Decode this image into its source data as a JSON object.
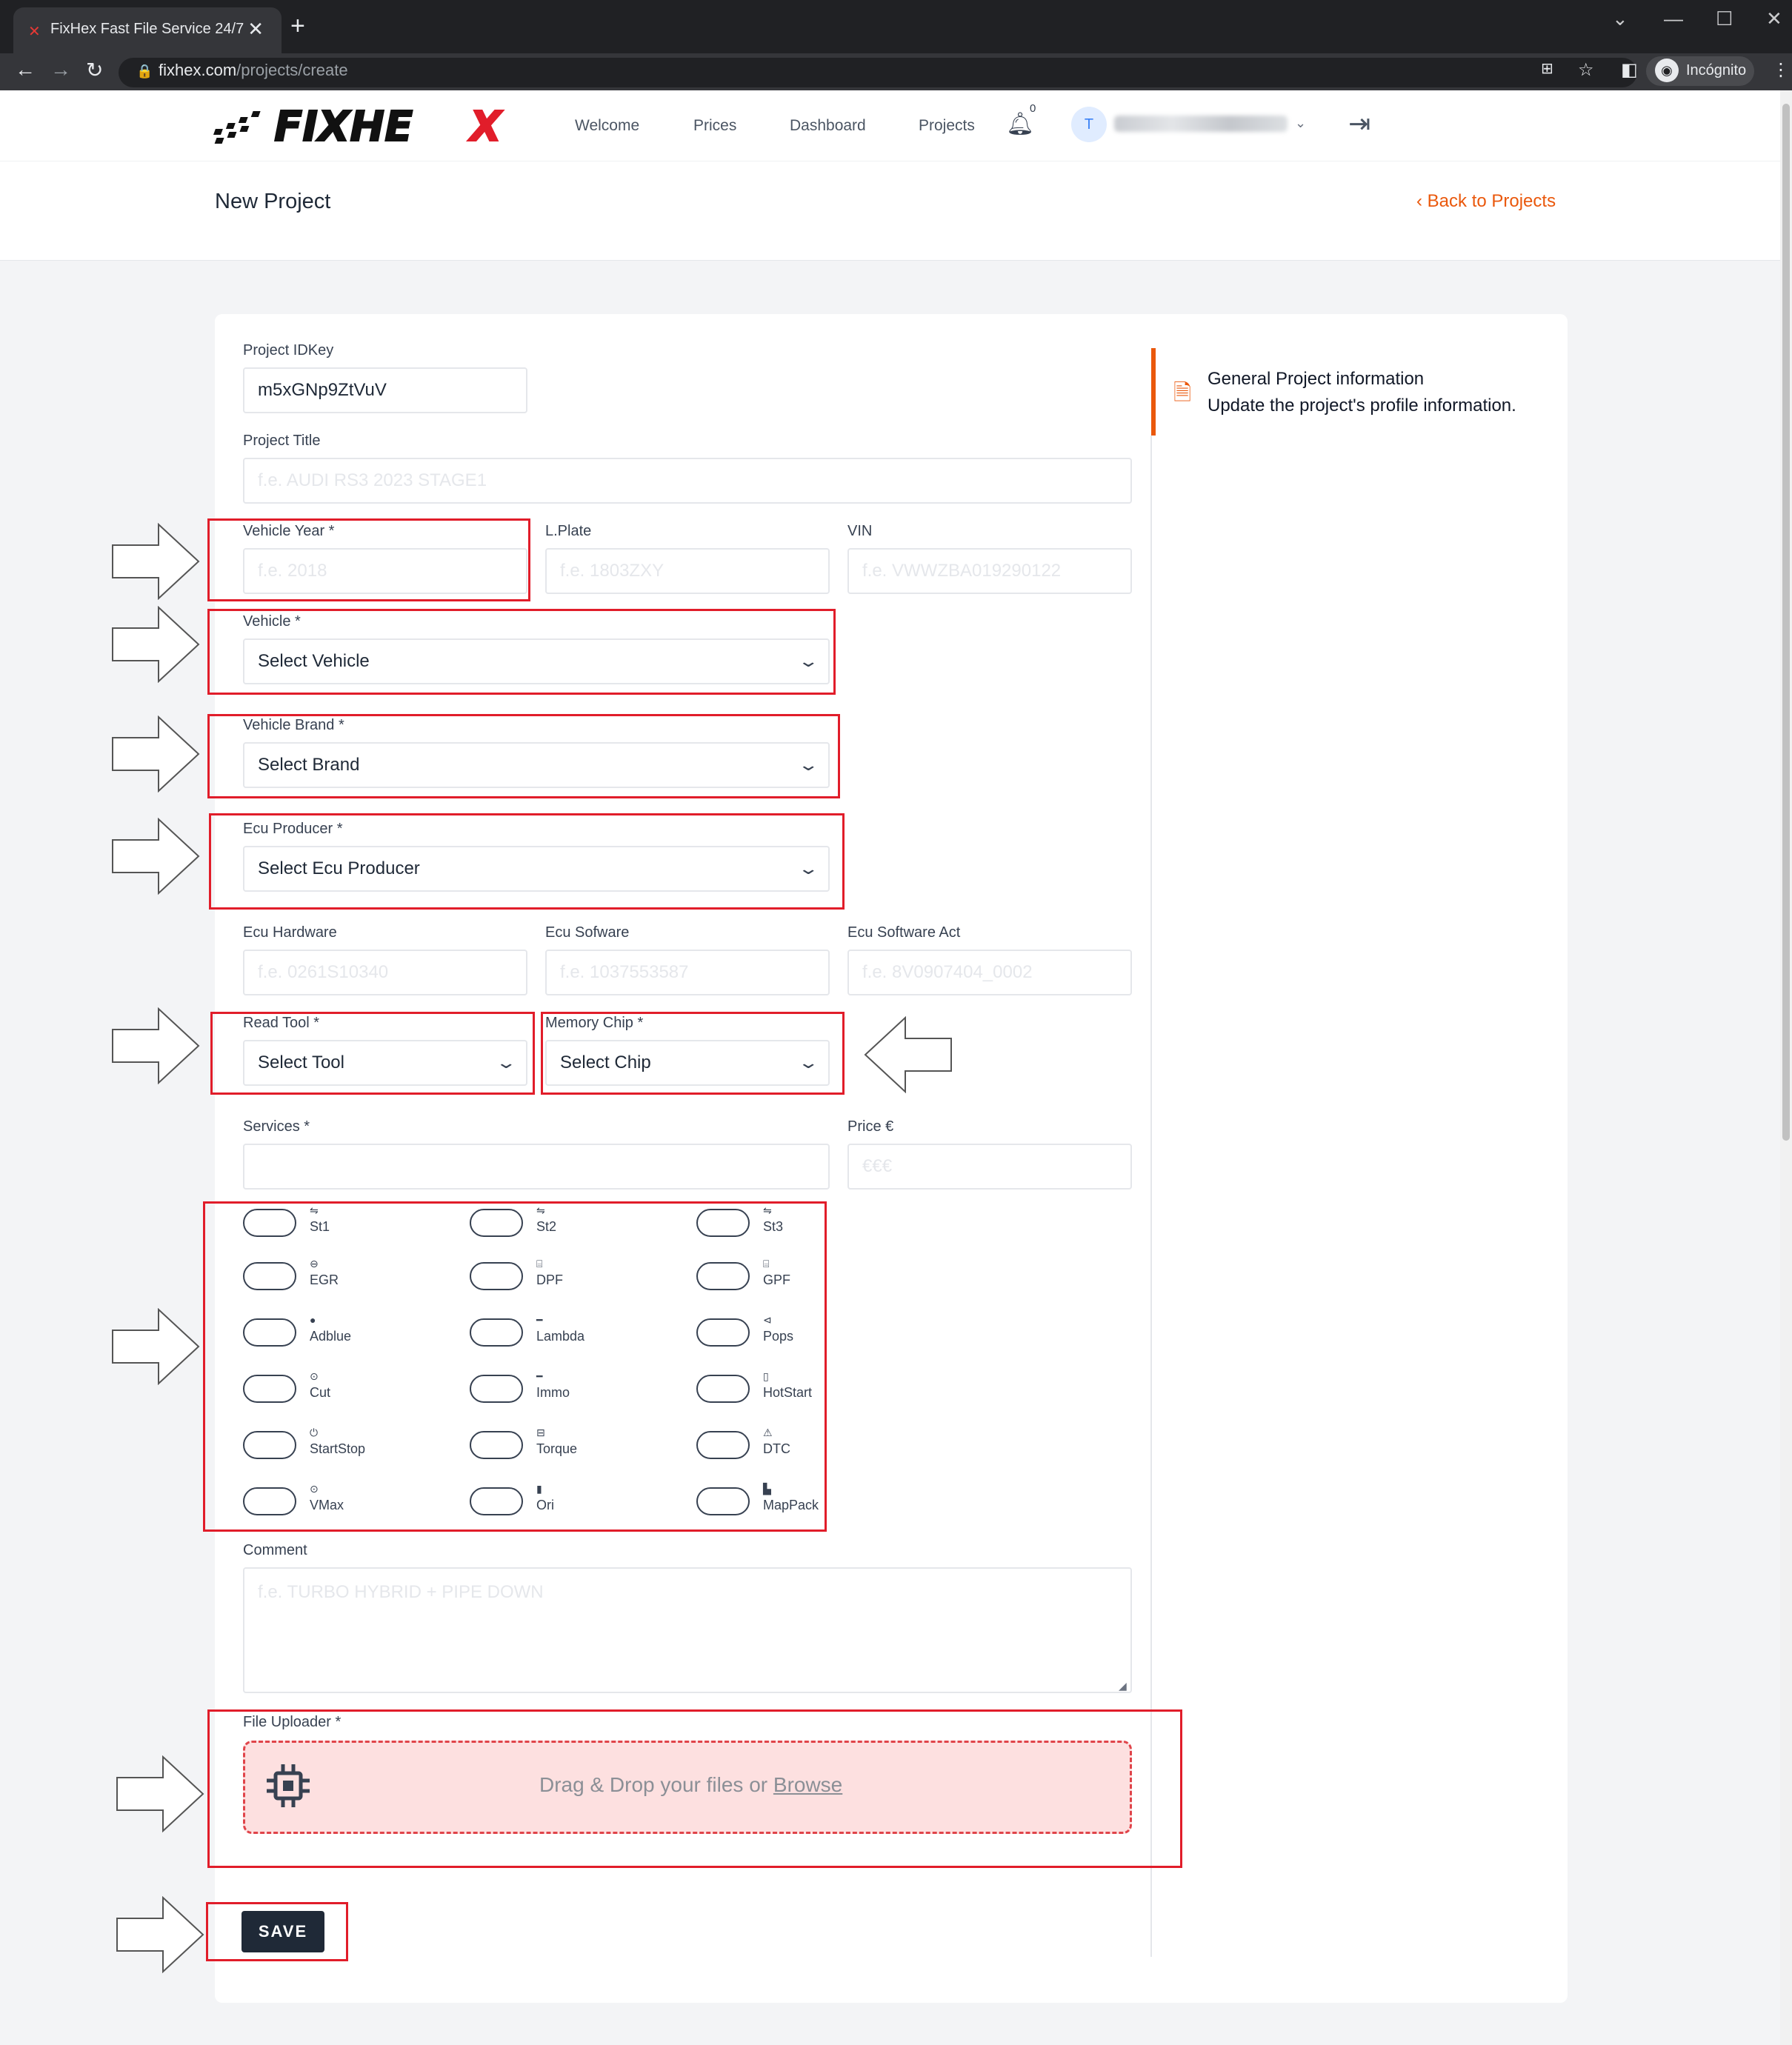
{
  "browser": {
    "tab_title": "FixHex Fast File Service 24/7",
    "tab_close": "✕",
    "new_tab": "+",
    "url_host": "fixhex.com",
    "url_path": "/projects/create",
    "profile_label": "Incógnito",
    "icons": [
      "back-arrow",
      "forward-arrow",
      "reload",
      "lock",
      "translate",
      "star",
      "sidebar",
      "incognito",
      "menu"
    ]
  },
  "header": {
    "logo_text": "FIXHEX",
    "nav": [
      "Welcome",
      "Prices",
      "Dashboard",
      "Projects"
    ],
    "notification_count": "0",
    "avatar_initial": "T",
    "page_title": "New Project",
    "back_label": "Back to Projects",
    "accent": "#ea580c"
  },
  "form": {
    "project_idkey": {
      "label": "Project IDKey",
      "value": "m5xGNp9ZtVuV"
    },
    "project_title": {
      "label": "Project Title",
      "placeholder": "f.e.  AUDI RS3 2023 STAGE1"
    },
    "vehicle_year": {
      "label": "Vehicle Year *",
      "placeholder": "f.e.  2018"
    },
    "plate": {
      "label": "L.Plate",
      "placeholder": "f.e.  1803ZXY"
    },
    "vin": {
      "label": "VIN",
      "placeholder": "f.e.  VWWZBA019290122"
    },
    "vehicle": {
      "label": "Vehicle *",
      "selected": "Select Vehicle"
    },
    "brand": {
      "label": "Vehicle Brand *",
      "selected": "Select Brand"
    },
    "ecu_producer": {
      "label": "Ecu Producer *",
      "selected": "Select Ecu Producer"
    },
    "ecu_hardware": {
      "label": "Ecu Hardware",
      "placeholder": "f.e.  0261S10340"
    },
    "ecu_software": {
      "label": "Ecu Sofware",
      "placeholder": "f.e.  1037553587"
    },
    "ecu_software_act": {
      "label": "Ecu Software Act",
      "placeholder": "f.e.  8V0907404_0002"
    },
    "read_tool": {
      "label": "Read Tool *",
      "selected": "Select Tool"
    },
    "memory_chip": {
      "label": "Memory Chip *",
      "selected": "Select Chip"
    },
    "services": {
      "label": "Services *"
    },
    "price": {
      "label": "Price €",
      "placeholder": "€€€"
    },
    "comment": {
      "label": "Comment",
      "placeholder": "f.e.  TURBO HYBRID + PIPE DOWN"
    },
    "uploader": {
      "label": "File Uploader *",
      "text": "Drag & Drop your files or ",
      "browse": "Browse"
    },
    "save_label": "SAVE"
  },
  "service_options": [
    {
      "label": "St1",
      "icon": "⇋"
    },
    {
      "label": "St2",
      "icon": "⇋"
    },
    {
      "label": "St3",
      "icon": "⇋"
    },
    {
      "label": "EGR",
      "icon": "⊖"
    },
    {
      "label": "DPF",
      "icon": "⌸"
    },
    {
      "label": "GPF",
      "icon": "⌸"
    },
    {
      "label": "Adblue",
      "icon": "●"
    },
    {
      "label": "Lambda",
      "icon": "━"
    },
    {
      "label": "Pops",
      "icon": "⊲"
    },
    {
      "label": "Cut",
      "icon": "⊙"
    },
    {
      "label": "Immo",
      "icon": "━"
    },
    {
      "label": "HotStart",
      "icon": "▯"
    },
    {
      "label": "StartStop",
      "icon": "⏻"
    },
    {
      "label": "Torque",
      "icon": "⊟"
    },
    {
      "label": "DTC",
      "icon": "⚠"
    },
    {
      "label": "VMax",
      "icon": "⊙"
    },
    {
      "label": "Ori",
      "icon": "▮"
    },
    {
      "label": "MapPack",
      "icon": "▙"
    }
  ],
  "sidebar": {
    "title": "General Project information",
    "description": "Update the project's profile information."
  }
}
